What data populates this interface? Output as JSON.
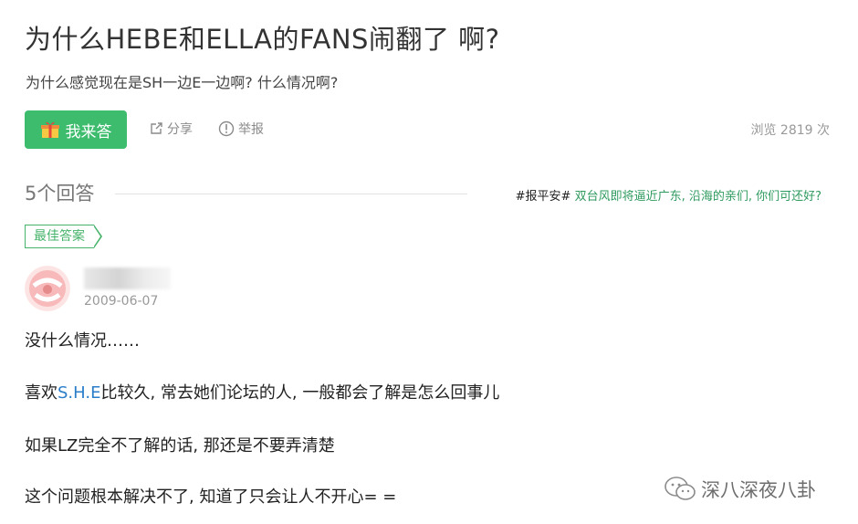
{
  "question": {
    "title": "为什么HEBE和ELLA的FANS闹翻了 啊?",
    "description": "为什么感觉现在是SH一边E一边啊? 什么情况啊?"
  },
  "actions": {
    "answer_label": "我来答",
    "share_label": "分享",
    "report_label": "举报",
    "views_text": "浏览 2819 次"
  },
  "answers_header": {
    "count_text": "5个回答",
    "promo_tag": "#报平安#",
    "promo_text": "双台风即将逼近广东, 沿海的亲们, 你们可还好?"
  },
  "best_answer": {
    "badge": "最佳答案",
    "date": "2009-06-07",
    "paragraphs": {
      "p1": "没什么情况……",
      "p2_pre": "喜欢",
      "p2_hl": "S.H.E",
      "p2_post": "比较久, 常去她们论坛的人, 一般都会了解是怎么回事儿",
      "p3": "如果LZ完全不了解的话, 那还是不要弄清楚",
      "p4": "这个问题根本解决不了, 知道了只会让人不开心= ="
    }
  },
  "watermark": {
    "text": "深八深夜八卦"
  },
  "colors": {
    "accent_green": "#3cbc6c",
    "link_green": "#2e9a5e",
    "highlight_blue": "#2a7dc9"
  }
}
